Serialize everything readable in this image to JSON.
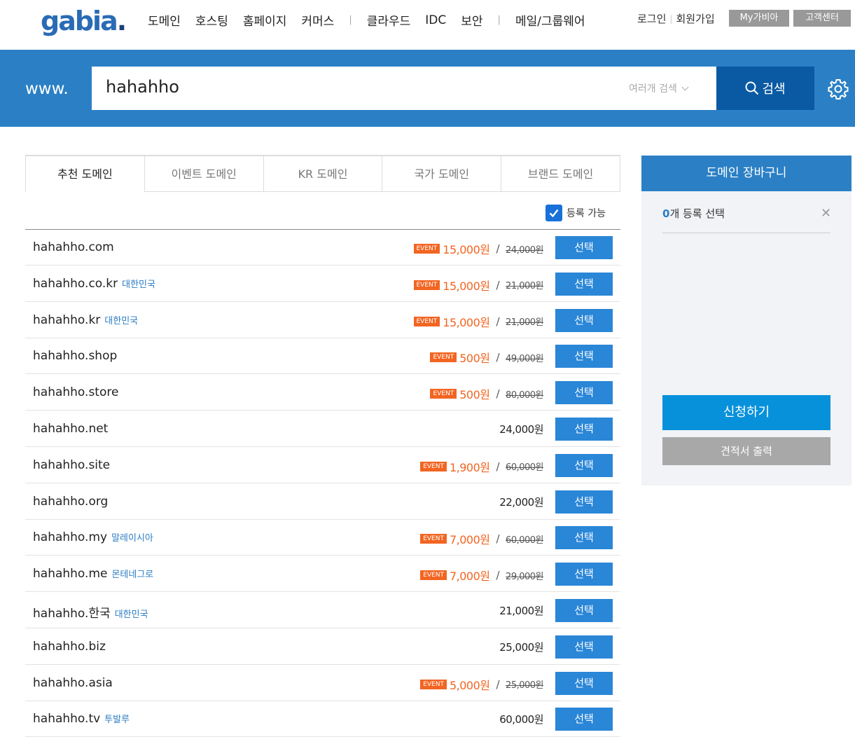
{
  "header": {
    "logo": "gabia",
    "logo_dot": ".",
    "nav": [
      "도메인",
      "호스팅",
      "홈페이지",
      "커머스",
      "클라우드",
      "IDC",
      "보안",
      "메일/그룹웨어"
    ],
    "login": "로그인",
    "signup": "회원가입",
    "my_gabia": "My가비아",
    "support": "고객센터"
  },
  "search": {
    "prefix": "www.",
    "query": "hahahho",
    "multi_search": "여러개 검색",
    "button": "검색"
  },
  "tabs": [
    "추천 도메인",
    "이벤트 도메인",
    "KR 도메인",
    "국가 도메인",
    "브랜드 도메인"
  ],
  "available_filter": "등록 가능",
  "event_badge": "EVENT",
  "select_label": "선택",
  "domains": [
    {
      "name": "hahahho.com",
      "country": "",
      "event": true,
      "price": "15,000원",
      "old": "24,000원"
    },
    {
      "name": "hahahho.co.kr",
      "country": "대한민국",
      "event": true,
      "price": "15,000원",
      "old": "21,000원"
    },
    {
      "name": "hahahho.kr",
      "country": "대한민국",
      "event": true,
      "price": "15,000원",
      "old": "21,000원"
    },
    {
      "name": "hahahho.shop",
      "country": "",
      "event": true,
      "price": "500원",
      "old": "49,000원"
    },
    {
      "name": "hahahho.store",
      "country": "",
      "event": true,
      "price": "500원",
      "old": "80,000원"
    },
    {
      "name": "hahahho.net",
      "country": "",
      "event": false,
      "price": "24,000원",
      "old": ""
    },
    {
      "name": "hahahho.site",
      "country": "",
      "event": true,
      "price": "1,900원",
      "old": "60,000원"
    },
    {
      "name": "hahahho.org",
      "country": "",
      "event": false,
      "price": "22,000원",
      "old": ""
    },
    {
      "name": "hahahho.my",
      "country": "말레이시아",
      "event": true,
      "price": "7,000원",
      "old": "60,000원"
    },
    {
      "name": "hahahho.me",
      "country": "몬테네그로",
      "event": true,
      "price": "7,000원",
      "old": "29,000원"
    },
    {
      "name": "hahahho.한국",
      "country": "대한민국",
      "event": false,
      "price": "21,000원",
      "old": ""
    },
    {
      "name": "hahahho.biz",
      "country": "",
      "event": false,
      "price": "25,000원",
      "old": ""
    },
    {
      "name": "hahahho.asia",
      "country": "",
      "event": true,
      "price": "5,000원",
      "old": "25,000원"
    },
    {
      "name": "hahahho.tv",
      "country": "투발루",
      "event": false,
      "price": "60,000원",
      "old": ""
    }
  ],
  "cart": {
    "title": "도메인 장바구니",
    "count": "0",
    "count_suffix": "개 등록 선택",
    "close": "✕",
    "apply": "신청하기",
    "quote": "견적서 출력"
  }
}
